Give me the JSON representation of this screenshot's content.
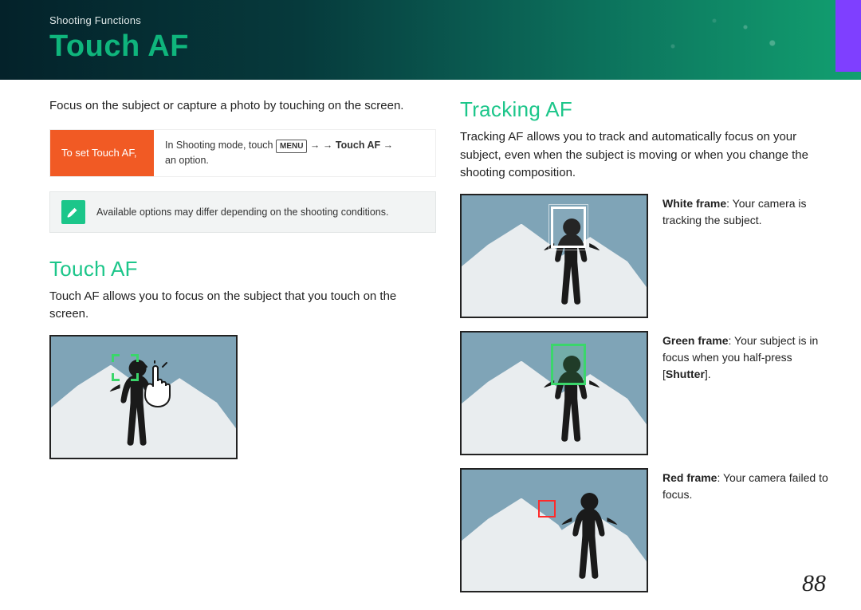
{
  "header": {
    "breadcrumb": "Shooting Functions",
    "title": "Touch AF"
  },
  "left": {
    "intro": "Focus on the subject or capture a photo by touching on the screen.",
    "instruct_label": "To set Touch AF,",
    "instruct_pre": "In Shooting mode, touch ",
    "instruct_menu": "MENU",
    "instruct_arrow1": " → ",
    "instruct_mid": " → ",
    "instruct_bold": "Touch AF",
    "instruct_arrow2": " → ",
    "instruct_post": "an option.",
    "note": "Available options may differ depending on the shooting conditions.",
    "sec_title": "Touch AF",
    "sec_desc": "Touch AF allows you to focus on the subject that you touch on the screen."
  },
  "right": {
    "sec_title": "Tracking AF",
    "sec_desc": "Tracking AF allows you to track and automatically focus on your subject, even when the subject is moving or when you change the shooting composition.",
    "cap1_b": "White frame",
    "cap1_t": ": Your camera is tracking the subject.",
    "cap2_b": "Green frame",
    "cap2_t1": ": Your subject is in focus when you half-press [",
    "cap2_b2": "Shutter",
    "cap2_t2": "].",
    "cap3_b": "Red frame",
    "cap3_t": ": Your camera failed to focus."
  },
  "page_number": "88"
}
